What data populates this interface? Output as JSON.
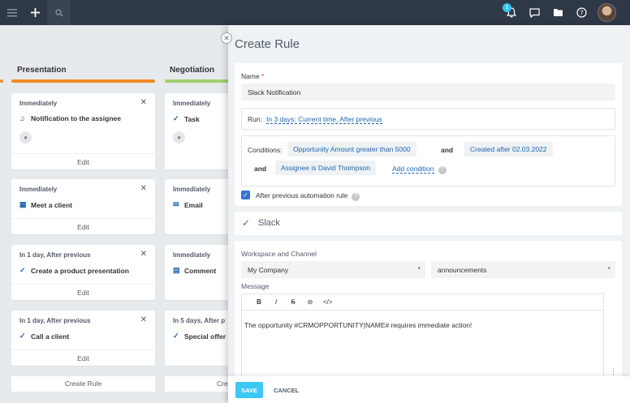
{
  "topbar": {
    "notification_count": "1"
  },
  "kanban": {
    "columns": [
      {
        "title": "Presentation",
        "color": "#f08a24"
      },
      {
        "title": "Negotiation",
        "color": "#9fd16f"
      }
    ],
    "cards_col1": [
      {
        "when": "Immediately",
        "action": "Notification to the assignee",
        "edit": "Edit"
      },
      {
        "when": "Immediately",
        "action": "Meet a client",
        "edit": "Edit"
      },
      {
        "when": "In 1 day, After previous",
        "action": "Create a product presentation",
        "edit": "Edit"
      },
      {
        "when": "In 1 day, After previous",
        "action": "Call a client",
        "edit": "Edit"
      }
    ],
    "cards_col2": [
      {
        "when": "Immediately",
        "action": "Task"
      },
      {
        "when": "Immediately",
        "action": "Email"
      },
      {
        "when": "Immediately",
        "action": "Comment"
      },
      {
        "when": "In 5 days, After p",
        "action": "Special offer"
      }
    ],
    "create_rule_1": "Create Rule",
    "create_rule_2": "Cre"
  },
  "panel": {
    "title": "Create Rule",
    "name_label": "Name",
    "name_required": "*",
    "name_value": "Slack Notification",
    "run_label": "Run:",
    "run_value": "In 3 days: Current time, After previous",
    "conditions_label": "Conditions:",
    "condition_1": "Opportunity Amount greater than 5000",
    "and_1": "and",
    "condition_2": "Created after 02.03.2022",
    "and_2": "and",
    "condition_3": "Assignee is David Thompson",
    "add_condition": "Add condition",
    "after_previous_label": "After previous automation rule",
    "slack_title": "Slack",
    "workspace_label": "Workspace and Channel",
    "workspace_value": "My Company",
    "channel_value": "announcements",
    "message_label": "Message",
    "toolbar": {
      "bold": "B",
      "italic": "I",
      "strike": "S",
      "link": "⊖",
      "code": "</>"
    },
    "message_text": "The opportunity #CRMOPPORTUNITY|NAME# requires immediate action!",
    "save": "SAVE",
    "cancel": "CANCEL"
  }
}
